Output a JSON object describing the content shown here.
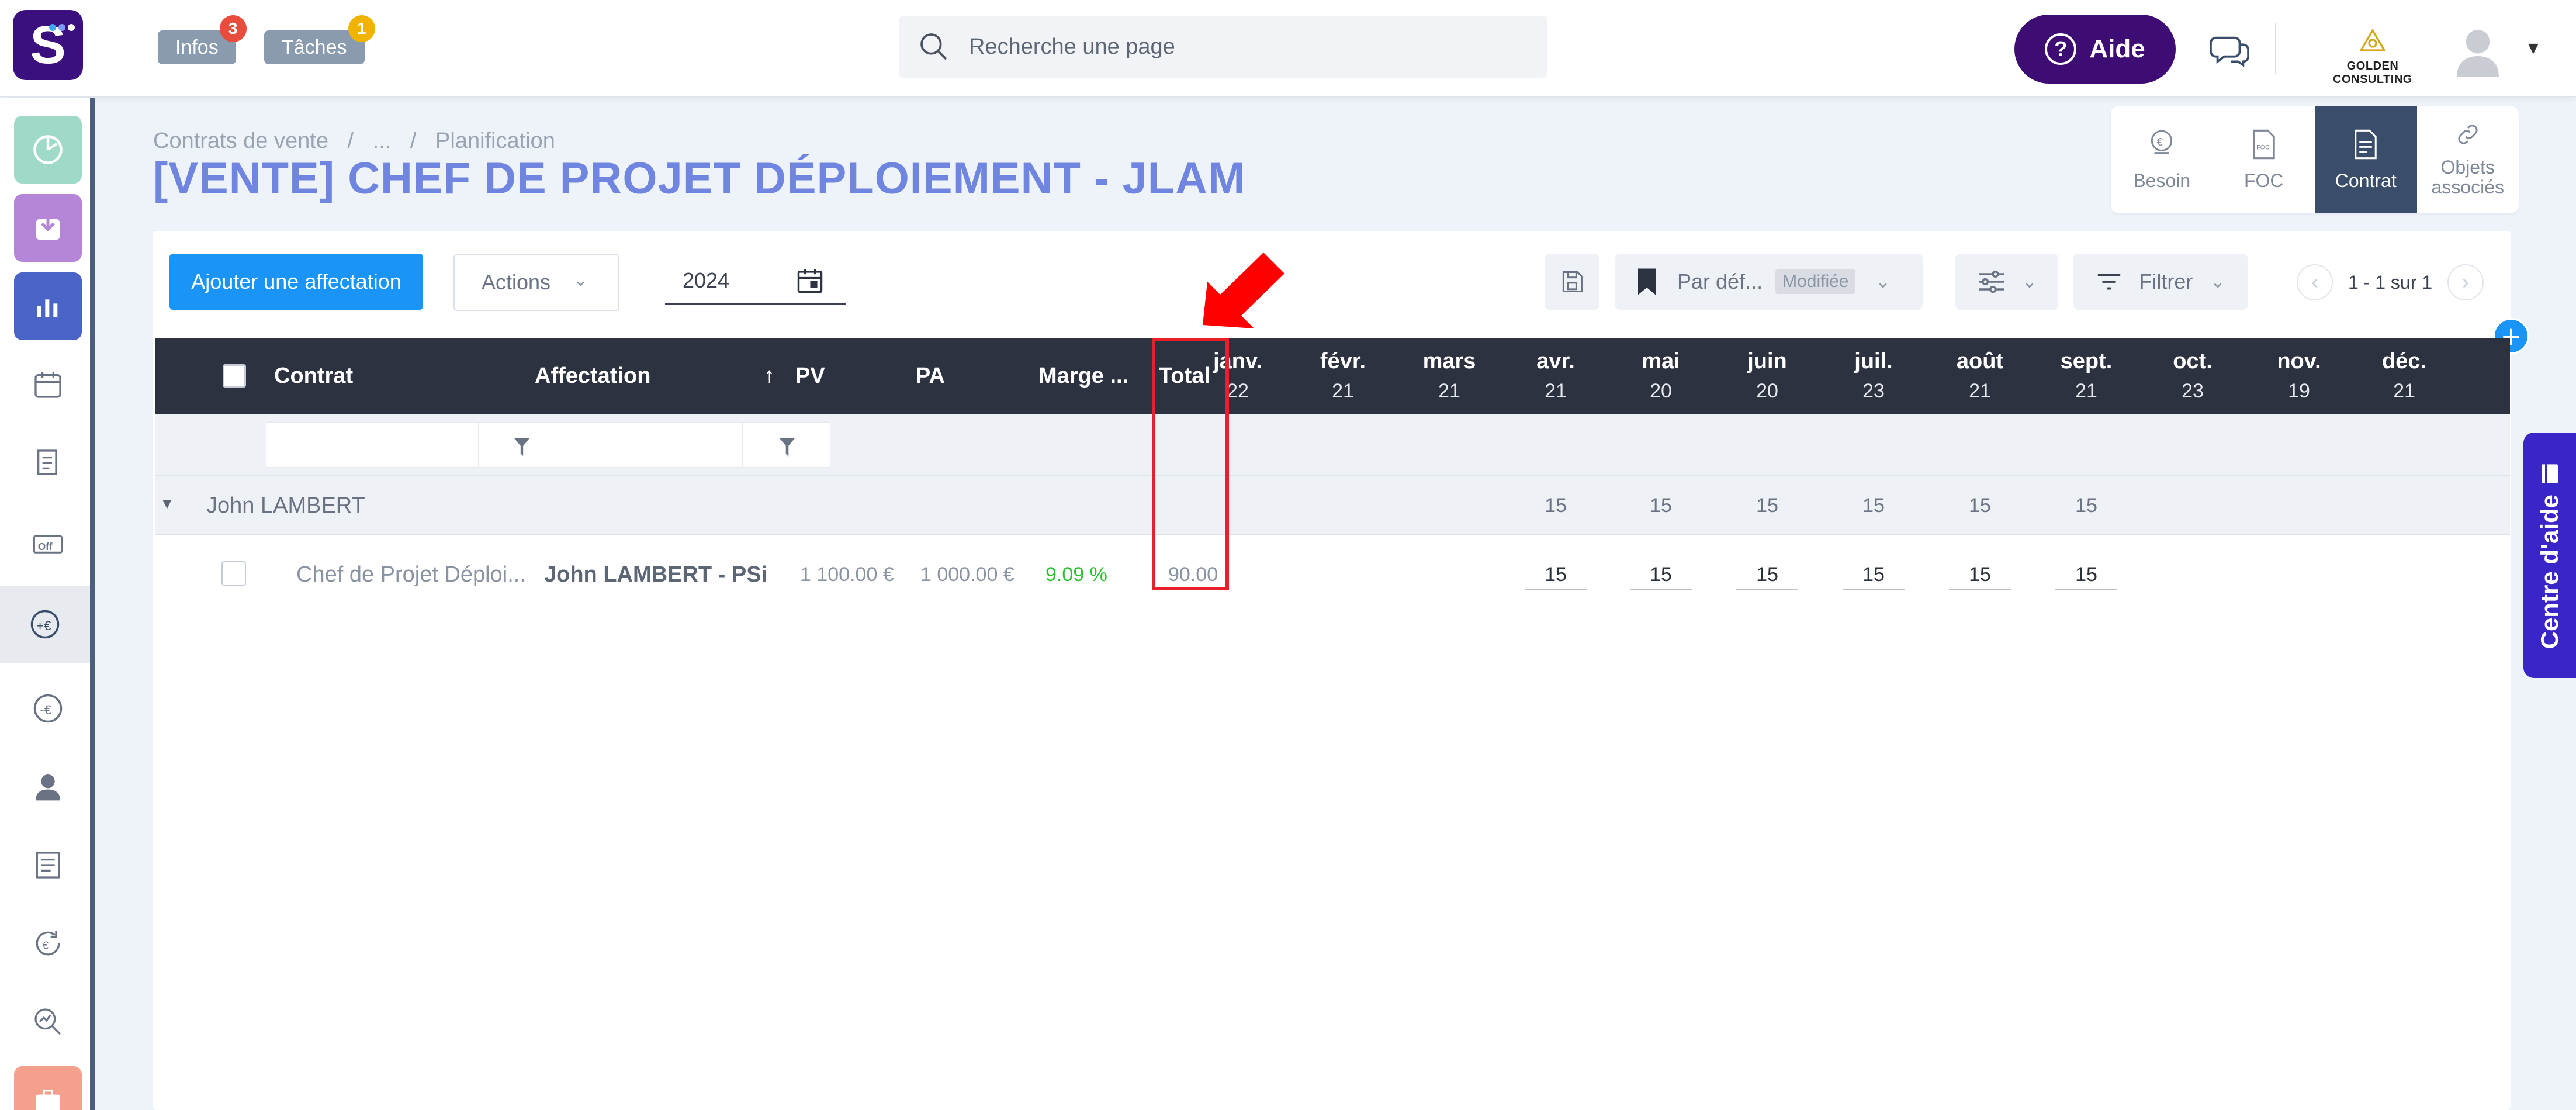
{
  "topbar": {
    "infos_label": "Infos",
    "infos_badge": "3",
    "taches_label": "Tâches",
    "taches_badge": "1",
    "search_placeholder": "Recherche une page",
    "aide_label": "Aide",
    "company_name": "GOLDEN CONSULTING",
    "badge_red": "#e74c3c",
    "badge_yellow": "#f0b400"
  },
  "sidebar": {
    "items": [
      {
        "name": "dashboard-icon"
      },
      {
        "name": "inbox-download-icon"
      },
      {
        "name": "bar-chart-icon"
      },
      {
        "name": "calendar-icon"
      },
      {
        "name": "documents-icon"
      },
      {
        "name": "off-icon"
      },
      {
        "name": "sales-euro-icon"
      },
      {
        "name": "purchase-euro-icon"
      },
      {
        "name": "user-icon"
      },
      {
        "name": "report-icon"
      },
      {
        "name": "euro-cycle-icon"
      },
      {
        "name": "analytics-search-icon"
      },
      {
        "name": "briefcase-icon"
      }
    ]
  },
  "breadcrumb": {
    "part1": "Contrats de vente",
    "sep1": "/",
    "part2": "...",
    "sep2": "/",
    "part3": "Planification"
  },
  "page_title": "[VENTE] CHEF DE PROJET DÉPLOIEMENT - JLAM",
  "tabs": [
    {
      "label": "Besoin",
      "icon": "euro-pin-icon"
    },
    {
      "label": "FOC",
      "icon": "foc-doc-icon"
    },
    {
      "label": "Contrat",
      "icon": "contract-icon"
    },
    {
      "label_line1": "Objets",
      "label_line2": "associés",
      "icon": "link-icon"
    }
  ],
  "toolbar": {
    "add_label": "Ajouter une affectation",
    "actions_label": "Actions",
    "year_value": "2024",
    "view_label": "Par déf...",
    "view_tag": "Modifiée",
    "filter_label": "Filtrer",
    "pagination_text": "1 - 1 sur 1"
  },
  "table": {
    "headers": {
      "contrat": "Contrat",
      "affectation": "Affectation",
      "pv": "PV",
      "pa": "PA",
      "marge": "Marge ...",
      "total": "Total",
      "sort_arrow": "↑"
    },
    "months": [
      {
        "name": "janv.",
        "value": "22"
      },
      {
        "name": "févr.",
        "value": "21"
      },
      {
        "name": "mars",
        "value": "21"
      },
      {
        "name": "avr.",
        "value": "21"
      },
      {
        "name": "mai",
        "value": "20"
      },
      {
        "name": "juin",
        "value": "20"
      },
      {
        "name": "juil.",
        "value": "23"
      },
      {
        "name": "août",
        "value": "21"
      },
      {
        "name": "sept.",
        "value": "21"
      },
      {
        "name": "oct.",
        "value": "23"
      },
      {
        "name": "nov.",
        "value": "19"
      },
      {
        "name": "déc.",
        "value": "21"
      }
    ],
    "group": {
      "name": "John LAMBERT",
      "month_values": [
        "",
        "",
        "",
        "15",
        "15",
        "15",
        "15",
        "15",
        "15",
        "",
        "",
        ""
      ]
    },
    "rows": [
      {
        "contrat": "Chef de Projet Déploi...",
        "affectation": "John LAMBERT - PSi",
        "pv": "1 100.00 €",
        "pa": "1 000.00 €",
        "marge": "9.09 %",
        "total": "90.00",
        "month_values": [
          "",
          "",
          "",
          "15",
          "15",
          "15",
          "15",
          "15",
          "15",
          "",
          "",
          ""
        ]
      }
    ]
  },
  "help_center_label": "Centre d'aide",
  "colors": {
    "accent_blue": "#1a94f6",
    "title_blue": "#6f85e0",
    "header_dark": "#2c3240",
    "margin_green": "#27c12e",
    "highlight_red": "#e8202a",
    "aide_purple": "#3d0d73"
  }
}
